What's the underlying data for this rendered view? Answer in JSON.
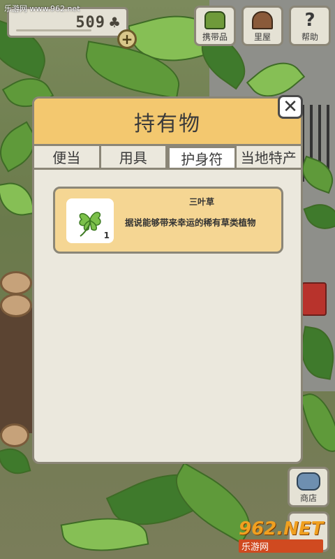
{
  "watermark_top": "乐游网 www.962.net",
  "counter": {
    "value": "509",
    "clover_icon": "clover-icon"
  },
  "plus_label": "+",
  "top_buttons": [
    {
      "label": "携带品",
      "icon": "bag-icon"
    },
    {
      "label": "里屋",
      "icon": "house-icon"
    },
    {
      "label": "帮助",
      "icon": "help-icon",
      "glyph": "?"
    }
  ],
  "panel": {
    "title": "持有物",
    "close_label": "✕",
    "tabs": [
      {
        "label": "便当",
        "active": false
      },
      {
        "label": "用具",
        "active": false
      },
      {
        "label": "护身符",
        "active": true
      },
      {
        "label": "当地特产",
        "active": false
      }
    ],
    "items": [
      {
        "name": "三叶草",
        "description": "据说能够带来幸运的稀有草类植物",
        "quantity": "1",
        "icon": "four-leaf-clover-icon"
      }
    ]
  },
  "bottom_buttons": [
    {
      "label": "商店",
      "icon": "shop-icon"
    }
  ],
  "watermark_bottom": {
    "main": "962.NET",
    "sub": "乐游网"
  },
  "colors": {
    "header": "#f3c86f",
    "panel_bg": "#ebe8dd",
    "card_bg": "#f5d693",
    "border": "#8b8677"
  }
}
